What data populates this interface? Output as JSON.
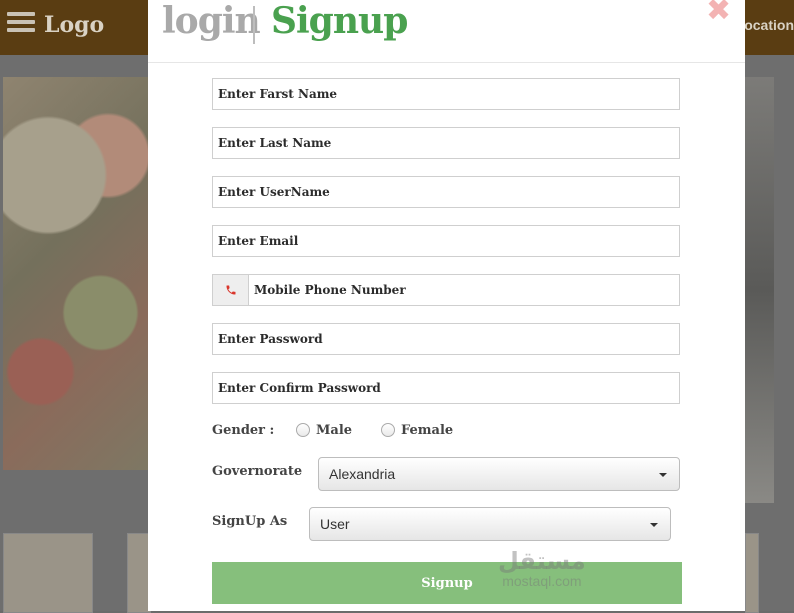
{
  "background": {
    "logo": "Logo",
    "location_partial": "ocation"
  },
  "modal": {
    "tabs": {
      "login": "login",
      "signup": "Signup"
    },
    "close_icon": "✖",
    "fields": {
      "first_name": "Enter Farst Name",
      "last_name": "Enter Last Name",
      "username": "Enter UserName",
      "email": "Enter Email",
      "mobile": "Mobile Phone Number",
      "password": "Enter Password",
      "confirm_password": "Enter Confirm Password"
    },
    "gender": {
      "label": "Gender :",
      "options": [
        "Male",
        "Female"
      ]
    },
    "governorate": {
      "label": "Governorate",
      "selected": "Alexandria"
    },
    "signup_as": {
      "label": "SignUp As",
      "selected": "User"
    },
    "submit_label": "Signup",
    "watermark": {
      "arabic": "مستقل",
      "latin": "mostaql.com"
    }
  },
  "colors": {
    "signup_tab": "#4aa14f",
    "login_tab": "#a9a9a9",
    "submit_bg": "#86bf7c",
    "close_icon": "#f3b3b3",
    "phone_icon": "#d9362c"
  }
}
